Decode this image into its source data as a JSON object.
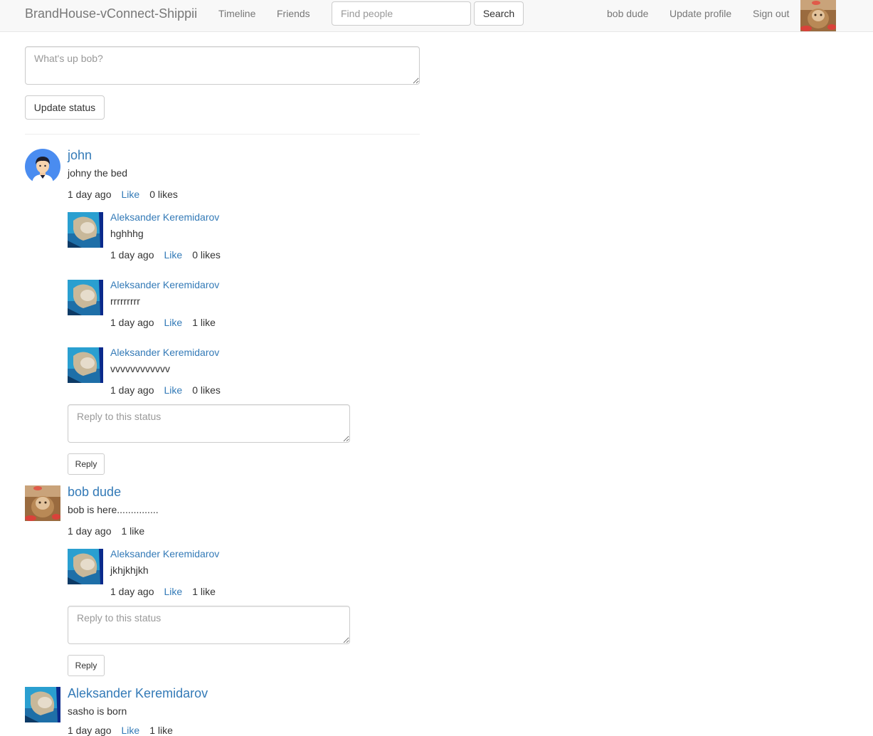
{
  "navbar": {
    "brand": "BrandHouse-vConnect-Shippii",
    "links": {
      "timeline": "Timeline",
      "friends": "Friends"
    },
    "search": {
      "placeholder": "Find people",
      "button": "Search"
    },
    "user_name": "bob dude",
    "update_profile": "Update profile",
    "sign_out": "Sign out"
  },
  "composer": {
    "placeholder": "What's up bob?",
    "button": "Update status"
  },
  "statuses": [
    {
      "author": "john",
      "text": "johny the bed",
      "time": "1 day ago",
      "like_label": "Like",
      "likes": "0 likes",
      "replies": [
        {
          "author": "Aleksander Keremidarov",
          "text": "hghhhg",
          "time": "1 day ago",
          "like_label": "Like",
          "likes": "0 likes"
        },
        {
          "author": "Aleksander Keremidarov",
          "text": "rrrrrrrrr",
          "time": "1 day ago",
          "like_label": "Like",
          "likes": "1 like"
        },
        {
          "author": "Aleksander Keremidarov",
          "text": "vvvvvvvvvvvv",
          "time": "1 day ago",
          "like_label": "Like",
          "likes": "0 likes"
        }
      ],
      "reply_placeholder": "Reply to this status",
      "reply_button": "Reply"
    },
    {
      "author": "bob dude",
      "text": "bob is here...............",
      "time": "1 day ago",
      "likes": "1 like",
      "replies": [
        {
          "author": "Aleksander Keremidarov",
          "text": "jkhjkhjkh",
          "time": "1 day ago",
          "like_label": "Like",
          "likes": "1 like"
        }
      ],
      "reply_placeholder": "Reply to this status",
      "reply_button": "Reply"
    },
    {
      "author": "Aleksander Keremidarov",
      "text": "sasho is born",
      "time": "1 day ago",
      "like_label": "Like",
      "likes": "1 like"
    }
  ],
  "colors": {
    "link": "#337ab7",
    "navbar_bg": "#f8f8f8",
    "nav_text": "#777777",
    "border": "#cccccc"
  }
}
